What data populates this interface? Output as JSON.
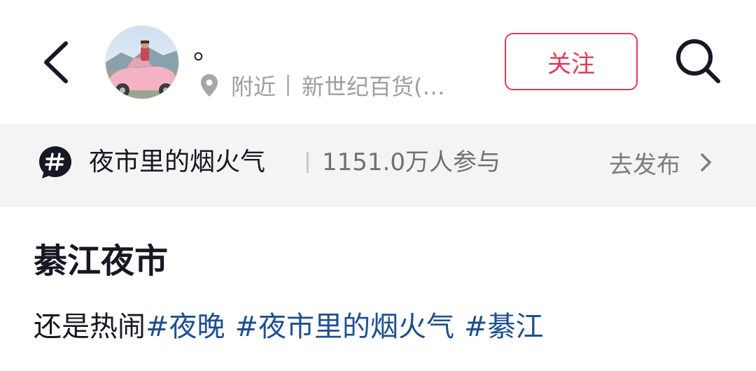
{
  "header": {
    "back_icon": "chevron-left-icon",
    "username": "。",
    "location": {
      "pin_icon": "location-pin-icon",
      "nearby_label": "附近",
      "place_name": "新世纪百货(…"
    },
    "follow_label": "关注",
    "search_icon": "search-icon",
    "accent_color": "#e33a58"
  },
  "topic_bar": {
    "icon": "hashtag-bubble-icon",
    "topic_name": "夜市里的烟火气",
    "participants": "1151.0万人参与",
    "publish_label": "去发布",
    "chevron_icon": "chevron-right-icon"
  },
  "post": {
    "title": "綦江夜市",
    "description_text": "还是热闹",
    "hashtags": [
      "#夜晚",
      "#夜市里的烟火气",
      "#綦江"
    ],
    "hashtag_color": "#1e4f8f"
  }
}
